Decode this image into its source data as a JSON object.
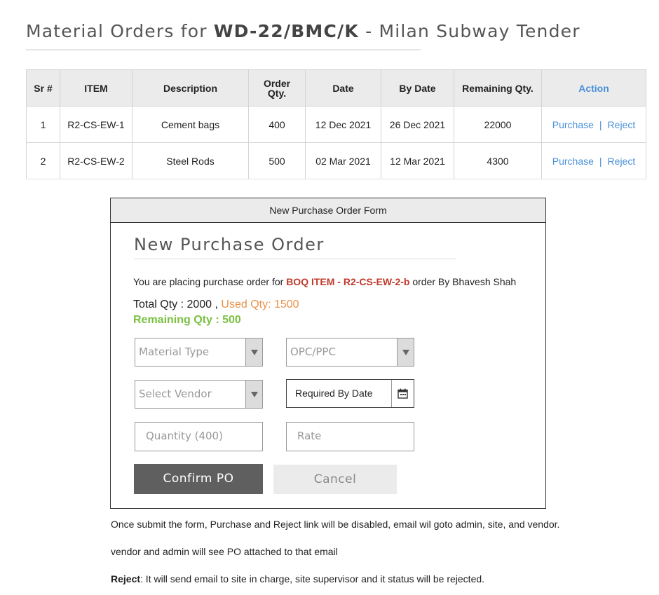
{
  "header": {
    "title_prefix": "Material Orders for",
    "tender_code": "WD-22/BMC/K",
    "title_suffix": "- Milan Subway Tender"
  },
  "table": {
    "columns": [
      "Sr #",
      "ITEM",
      "Description",
      "Order Qty.",
      "Date",
      "By Date",
      "Remaining Qty.",
      "Action"
    ],
    "rows": [
      {
        "sr": "1",
        "item": "R2-CS-EW-1",
        "description": "Cement bags",
        "order_qty": "400",
        "date": "12 Dec 2021",
        "by_date": "26 Dec 2021",
        "remaining_qty": "22000",
        "purchase": "Purchase",
        "separator": "|",
        "reject": "Reject"
      },
      {
        "sr": "2",
        "item": "R2-CS-EW-2",
        "description": "Steel Rods",
        "order_qty": "500",
        "date": "02 Mar 2021",
        "by_date": "12 Mar 2021",
        "remaining_qty": "4300",
        "purchase": "Purchase",
        "separator": "|",
        "reject": "Reject"
      }
    ]
  },
  "form": {
    "panel_title": "New Purchase Order Form",
    "title": "New Purchase Order",
    "placing_prefix": "You are placing purchase order for",
    "boq_item": "BOQ ITEM - R2-CS-EW-2-b",
    "placing_suffix": "order By Bhavesh Shah",
    "total_qty": "Total Qty : 2000 ,",
    "used_qty": "Used Qty: 1500",
    "remaining_qty": "Remaining Qty : 500",
    "material_type_placeholder": "Material Type",
    "cement_type_placeholder": "OPC/PPC",
    "vendor_placeholder": "Select Vendor",
    "required_by_date": "Required By Date",
    "quantity_placeholder": "Quantity (400)",
    "rate_placeholder": "Rate",
    "confirm_label": "Confirm PO",
    "cancel_label": "Cancel"
  },
  "notes": {
    "line1": "Once submit the form, Purchase and Reject link will be disabled, email wil goto admin, site, and vendor.",
    "line2": "vendor and admin will see PO attached to that email",
    "reject_label": "Reject",
    "reject_text": ": It will send email to site in charge, site supervisor and it status will be rejected."
  },
  "colors": {
    "link": "#4a90d9",
    "boq_red": "#c0392b",
    "used_orange": "#e8914a",
    "remaining_green": "#7ac142",
    "confirm_bg": "#5f5f5f"
  }
}
